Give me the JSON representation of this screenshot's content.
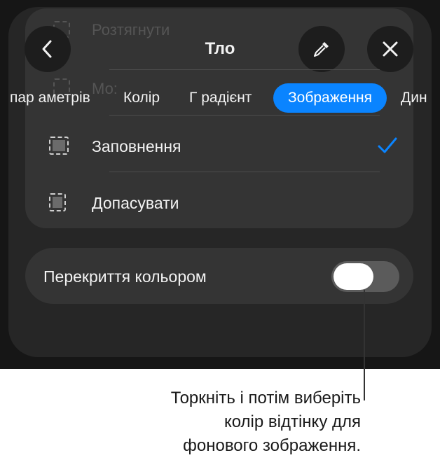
{
  "header": {
    "title": "Тло",
    "back_icon": "chevron-left-icon",
    "eyedropper_icon": "eyedropper-icon",
    "close_icon": "close-icon"
  },
  "background_ghost": {
    "row1": "Розтягнути",
    "row2": "Мо:"
  },
  "tabs": [
    {
      "label": "пар аметрів"
    },
    {
      "label": "Колір"
    },
    {
      "label": "Г радієнт"
    },
    {
      "label": "Зображення",
      "active": true
    },
    {
      "label": "Дин"
    }
  ],
  "options": [
    {
      "label": "Заповнення",
      "selected": true
    },
    {
      "label": "Допасувати",
      "selected": false
    }
  ],
  "overlay": {
    "label": "Перекриття кольором",
    "toggle_on": false
  },
  "callout": {
    "line1": "Торкніть і потім виберіть",
    "line2": "колір відтінку для",
    "line3": "фонового зображення."
  },
  "colors": {
    "accent": "#0a84ff",
    "panel": "#161616",
    "card": "#343434"
  }
}
